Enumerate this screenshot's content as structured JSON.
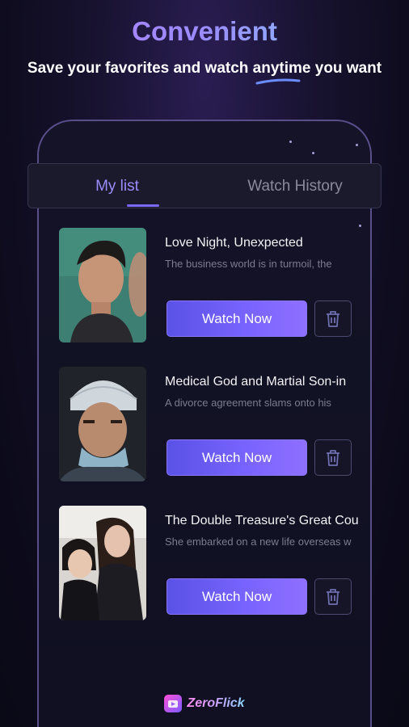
{
  "header": {
    "headline": "Convenient",
    "subline": "Save your favorites and watch anytime you want"
  },
  "tabs": [
    {
      "label": "My list",
      "active": true
    },
    {
      "label": "Watch History",
      "active": false
    }
  ],
  "items": [
    {
      "title": "Love Night, Unexpected",
      "description": "The business world is in turmoil, the",
      "watch_label": "Watch Now",
      "delete_icon": "trash-icon"
    },
    {
      "title": "Medical God and Martial Son-in",
      "description": "A divorce agreement slams onto his",
      "watch_label": "Watch Now",
      "delete_icon": "trash-icon"
    },
    {
      "title": "The Double Treasure's Great Cou",
      "description": "She embarked on a new life overseas w",
      "watch_label": "Watch Now",
      "delete_icon": "trash-icon"
    }
  ],
  "brand": {
    "name": "ZeroFlick"
  },
  "colors": {
    "accent": "#7a64ff",
    "tab_active": "#9a8cff",
    "background": "#0d0b1c"
  }
}
